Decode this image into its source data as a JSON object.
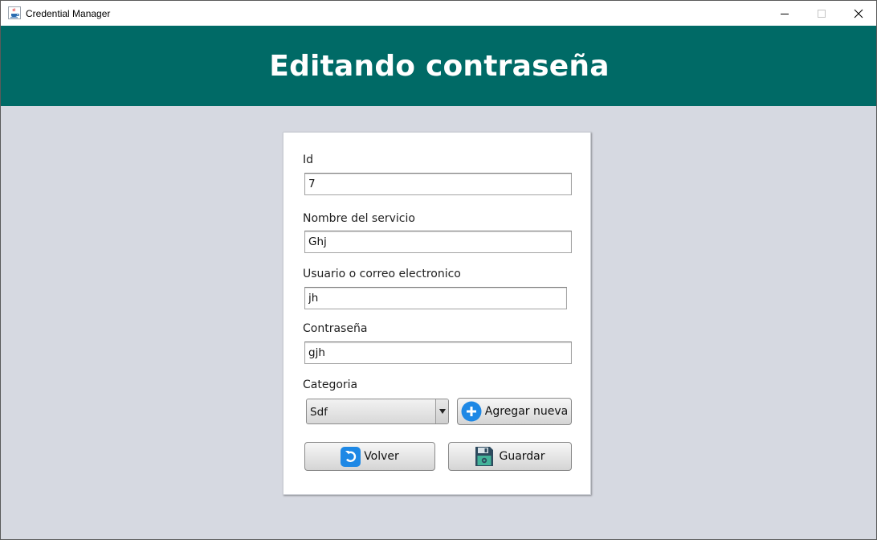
{
  "window": {
    "title": "Credential Manager",
    "controls": [
      "minimize",
      "maximize",
      "close"
    ]
  },
  "header": {
    "title": "Editando contraseña",
    "background": "#006a66"
  },
  "form": {
    "id_label": "Id",
    "id_value": "7",
    "service_label": "Nombre del servicio",
    "service_value": "Ghj",
    "user_label": "Usuario o correo electronico",
    "user_value": "jh",
    "password_label": "Contraseña",
    "password_value": "gjh",
    "category_label": "Categoria",
    "category_selected": "Sdf",
    "add_category_label": "Agregar nueva",
    "back_label": "Volver",
    "save_label": "Guardar"
  },
  "colors": {
    "accent_blue": "#1e88e5",
    "background": "#d6d9e1",
    "card": "#ffffff"
  },
  "icons": {
    "app": "java-cup-icon",
    "add": "plus-circle-icon",
    "back": "undo-icon",
    "save": "floppy-disk-icon"
  }
}
